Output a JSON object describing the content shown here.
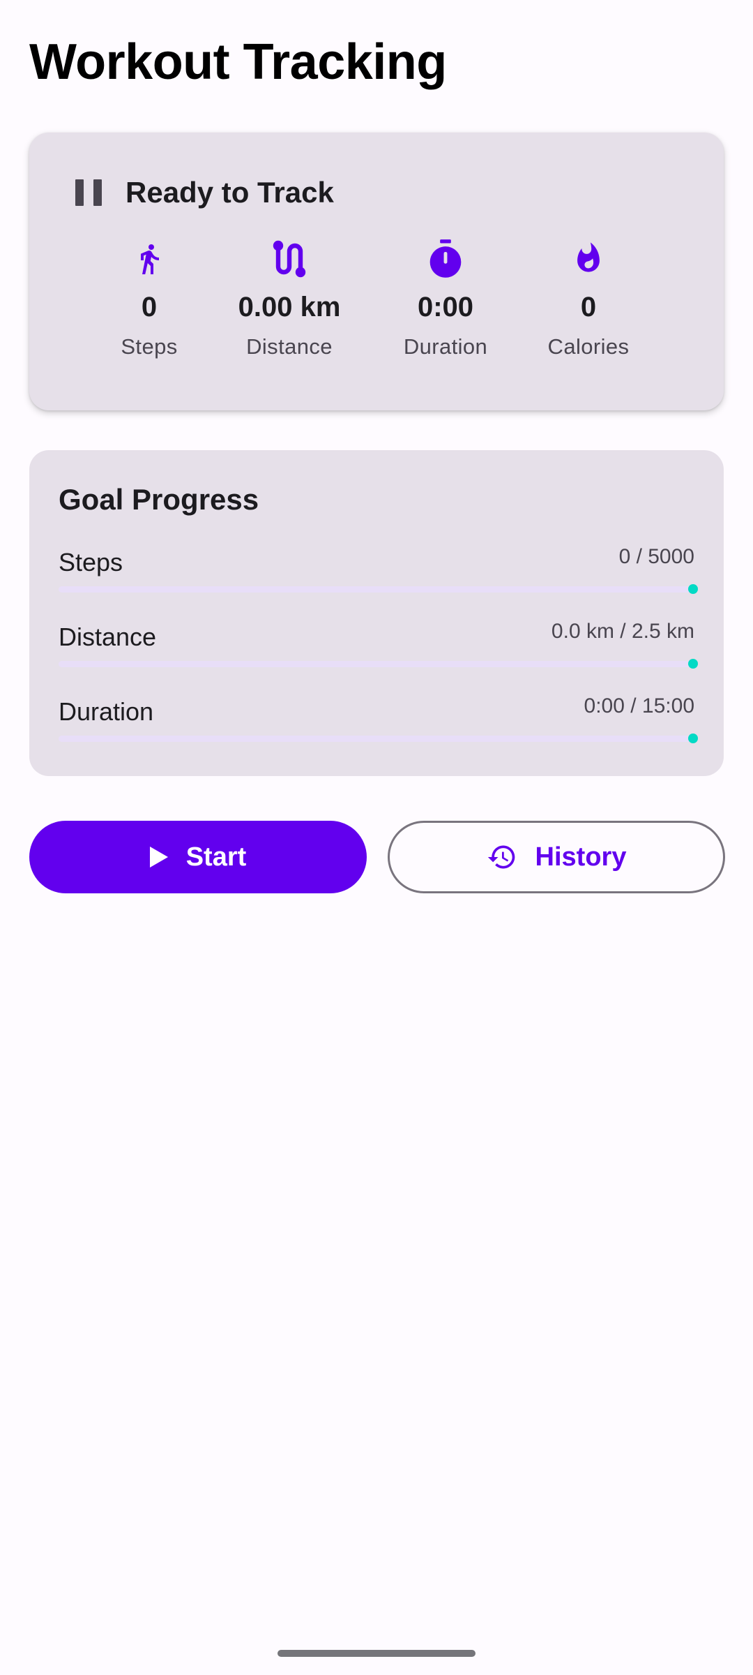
{
  "page": {
    "title": "Workout Tracking"
  },
  "status_card": {
    "state_text": "Ready to Track",
    "state_icon": "pause-icon",
    "stats": [
      {
        "icon": "walk-icon",
        "value": "0",
        "label": "Steps"
      },
      {
        "icon": "route-icon",
        "value": "0.00 km",
        "label": "Distance"
      },
      {
        "icon": "timer-icon",
        "value": "0:00",
        "label": "Duration"
      },
      {
        "icon": "flame-icon",
        "value": "0",
        "label": "Calories"
      }
    ]
  },
  "goal_card": {
    "title": "Goal Progress",
    "goals": [
      {
        "label": "Steps",
        "value_text": "0 / 5000",
        "progress": 0
      },
      {
        "label": "Distance",
        "value_text": "0.0 km / 2.5 km",
        "progress": 0
      },
      {
        "label": "Duration",
        "value_text": "0:00 / 15:00",
        "progress": 0
      }
    ]
  },
  "actions": {
    "start_label": "Start",
    "start_icon": "play-icon",
    "history_label": "History",
    "history_icon": "history-icon"
  },
  "colors": {
    "primary": "#6200ee",
    "accent": "#03dac5",
    "card_background": "#e6e0e9",
    "track": "#e8def8",
    "background": "#fefbff"
  }
}
